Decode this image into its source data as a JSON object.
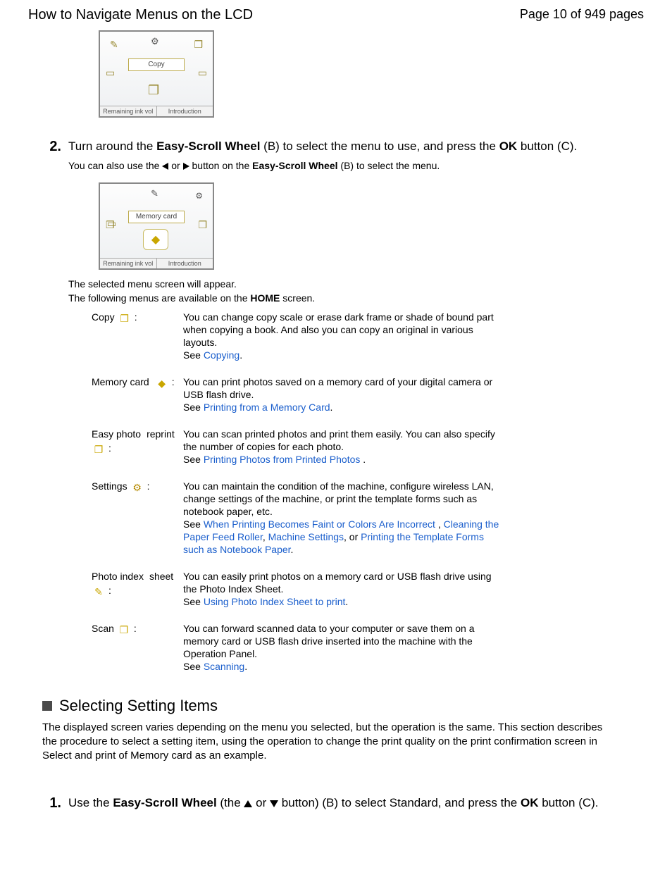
{
  "header": {
    "title": "How to Navigate Menus on the LCD",
    "page_indicator": "Page 10 of 949 pages"
  },
  "lcd1": {
    "center_label": "Copy",
    "tab_left": "Remaining ink vol",
    "tab_right": "Introduction"
  },
  "step2": {
    "num": "2.",
    "line1a": "Turn around the ",
    "wheel": "Easy-Scroll Wheel",
    "line1b": " (B) to select the menu to use, and press the ",
    "ok": "OK",
    "line1c": " button (C).",
    "sub_a": "You can also use the ",
    "sub_or": " or ",
    "sub_b": " button on the ",
    "sub_c": " (B) to select the menu."
  },
  "lcd2": {
    "center_label": "Memory card",
    "tab_left": "Remaining ink vol",
    "tab_right": "Introduction"
  },
  "after_lcd2_line1": "The selected menu screen will appear.",
  "after_lcd2_line2a": "The following menus are available on the ",
  "home_word": "HOME",
  "after_lcd2_line2b": " screen.",
  "menus": {
    "copy": {
      "label": "Copy",
      "desc": "You can change copy scale or erase dark frame or shade of bound part when copying a book. And also you can copy an original in various layouts.",
      "see": "See ",
      "link": "Copying",
      "tail": "."
    },
    "memory": {
      "label": "Memory card",
      "desc": "You can print photos saved on a memory card of your digital camera or USB flash drive.",
      "see": "See ",
      "link": "Printing from a Memory Card",
      "tail": "."
    },
    "easy": {
      "label1": "Easy photo",
      "label2": "reprint",
      "desc": "You can scan printed photos and print them easily. You can also specify the number of copies for each photo.",
      "see": "See ",
      "link": "Printing Photos from Printed Photos",
      "tail": " ."
    },
    "settings": {
      "label": "Settings",
      "desc": "You can maintain the condition of the machine, configure wireless LAN, change settings of the machine, or print the template forms such as notebook paper, etc.",
      "see": "See ",
      "link1": "When Printing Becomes Faint or Colors Are Incorrect",
      "sep1": " , ",
      "link2": "Cleaning the Paper Feed Roller",
      "sep2": ", ",
      "link3": "Machine Settings",
      "sep3": ", or ",
      "link4": "Printing the Template Forms such as Notebook Paper",
      "tail": "."
    },
    "photo": {
      "label1": "Photo index",
      "label2": "sheet",
      "desc": "You can easily print photos on a memory card or USB flash drive using the Photo Index Sheet.",
      "see": "See ",
      "link": "Using Photo Index Sheet to print",
      "tail": "."
    },
    "scan": {
      "label": "Scan",
      "desc": "You can forward scanned data to your computer or save them on a memory card or USB flash drive inserted into the machine with the Operation Panel.",
      "see": "See ",
      "link": "Scanning",
      "tail": "."
    }
  },
  "section2": {
    "title": "Selecting Setting Items",
    "para": "The displayed screen varies depending on the menu you selected, but the operation is the same. This section describes the procedure to select a setting item, using the operation to change the print quality on the print confirmation screen in Select and print of Memory card as an example."
  },
  "step1b": {
    "num": "1.",
    "a": "Use the ",
    "wheel": "Easy-Scroll Wheel",
    "b": " (the ",
    "or": " or ",
    "c": " button) (B) to select Standard, and press the ",
    "ok": "OK",
    "d": " button (C)."
  }
}
